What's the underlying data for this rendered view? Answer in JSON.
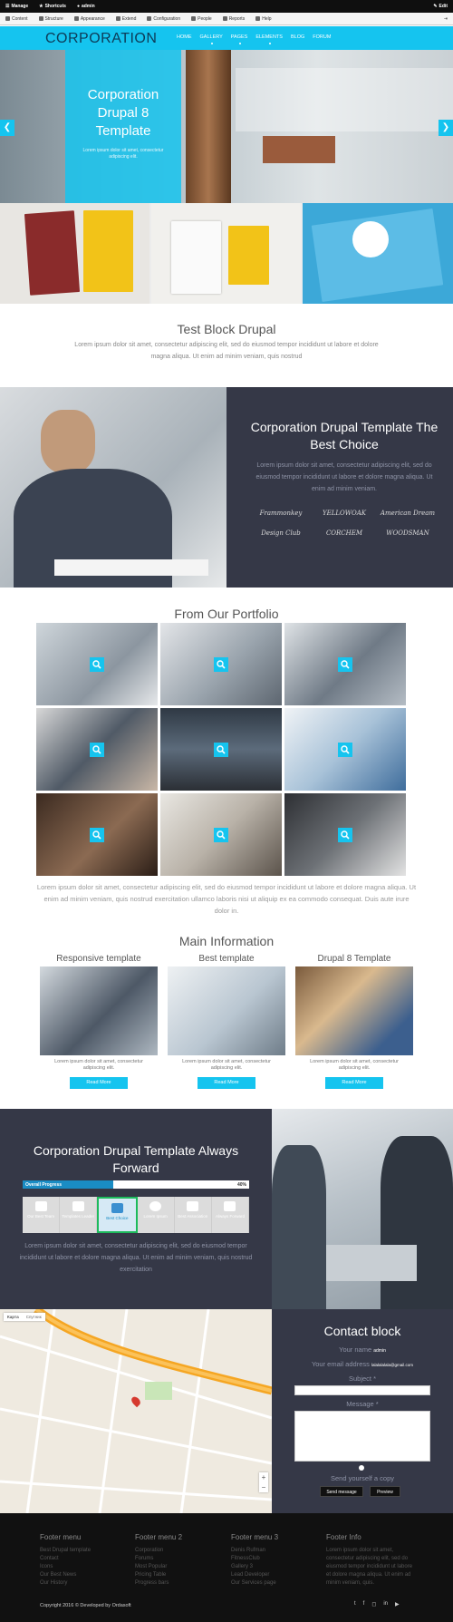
{
  "admin_bar": {
    "manage": "Manage",
    "shortcuts": "Shortcuts",
    "user": "admin",
    "edit": "Edit"
  },
  "admin_menu": [
    "Content",
    "Structure",
    "Appearance",
    "Extend",
    "Configuration",
    "People",
    "Reports",
    "Help"
  ],
  "site": {
    "logo": "CORPORATION"
  },
  "nav": [
    "HOME",
    "GALLERY",
    "PAGES",
    "ELEMENTS",
    "BLOG",
    "FORUM"
  ],
  "hero": {
    "title": "Corporation Drupal 8 Template",
    "subtitle": "Lorem ipsum dolor sit amet, consectetur adipiscing elit."
  },
  "block1": {
    "title": "Test Block Drupal",
    "text": "Lorem ipsum dolor sit amet, consectetur adipiscing elit, sed do eiusmod tempor incididunt ut labore et dolore magna aliqua. Ut enim ad minim veniam, quis nostrud"
  },
  "choice": {
    "title": "Corporation Drupal Template The Best Choice",
    "text": "Lorem ipsum dolor sit amet, consectetur adipiscing elit, sed do eiusmod tempor incididunt ut labore et dolore magna aliqua. Ut enim ad minim veniam.",
    "brands": [
      "Frammonkey",
      "YELLOWOAK",
      "American Dream",
      "Design Club",
      "CORCHEM",
      "WOODSMAN"
    ]
  },
  "portfolio": {
    "title": "From Our Portfolio",
    "text": "Lorem ipsum dolor sit amet, consectetur adipiscing elit, sed do eiusmod tempor incididunt ut labore et dolore magna aliqua. Ut enim ad minim veniam, quis nostrud exercitation ullamco laboris nisi ut aliquip ex ea commodo consequat. Duis aute irure dolor in."
  },
  "main_info": {
    "title": "Main Information",
    "cols": [
      {
        "title": "Responsive template",
        "text": "Lorem ipsum dolor sit amet, consectetur adipiscing elit.",
        "button": "Read More"
      },
      {
        "title": "Best template",
        "text": "Lorem ipsum dolor sit amet, consectetur adipiscing elit.",
        "button": "Read More"
      },
      {
        "title": "Drupal 8 Template",
        "text": "Lorem ipsum dolor sit amet, consectetur adipiscing elit.",
        "button": "Read More"
      }
    ]
  },
  "forward": {
    "title": "Corporation Drupal Template Always Forward",
    "progress_label": "Overall Progress",
    "progress_value": "40%",
    "progress": 0.4,
    "icons": [
      {
        "label": "Our Best Team"
      },
      {
        "label": "Templates Leader"
      },
      {
        "label": "Best Choice"
      },
      {
        "label": "Lorem Ipsum"
      },
      {
        "label": "Best Association"
      },
      {
        "label": "Always Forward"
      }
    ],
    "text": "Lorem ipsum dolor sit amet, consectetur adipiscing elit, sed do eiusmod tempor incididunt ut labore et dolore magna aliqua. Ut enim ad minim veniam, quis nostrud exercitation"
  },
  "map": {
    "tab_map": "Карта",
    "tab_sat": "Спутник"
  },
  "contact": {
    "title": "Contact block",
    "name_label": "Your name",
    "name_value": "admin",
    "email_label": "Your email address",
    "email_value": "lalalalalala@gmail.com",
    "subject_label": "Subject *",
    "message_label": "Message *",
    "copy_label": "Send yourself a copy",
    "send": "Send message",
    "preview": "Preview"
  },
  "footer": {
    "cols": [
      {
        "title": "Footer menu",
        "items": [
          "Best Drupal template",
          "Contact",
          "Icons",
          "Our Best News",
          "Our History"
        ]
      },
      {
        "title": "Footer menu 2",
        "items": [
          "Corporation",
          "Forums",
          "Most Popular",
          "Pricing Table",
          "Progress bars"
        ]
      },
      {
        "title": "Footer menu 3",
        "items": [
          "Denis Rufman",
          "FitnessClub",
          "Gallery 3",
          "Lead Developer",
          "Our Services page"
        ]
      },
      {
        "title": "Footer Info",
        "text": "Lorem ipsum dolor sit amet, consectetur adipiscing elit, sed do eiusmod tempor incididunt ut labore et dolore magna aliqua. Ut enim ad minim veniam, quis."
      }
    ],
    "copyright": "Copyright 2016 © Developed by Ordasoft"
  }
}
